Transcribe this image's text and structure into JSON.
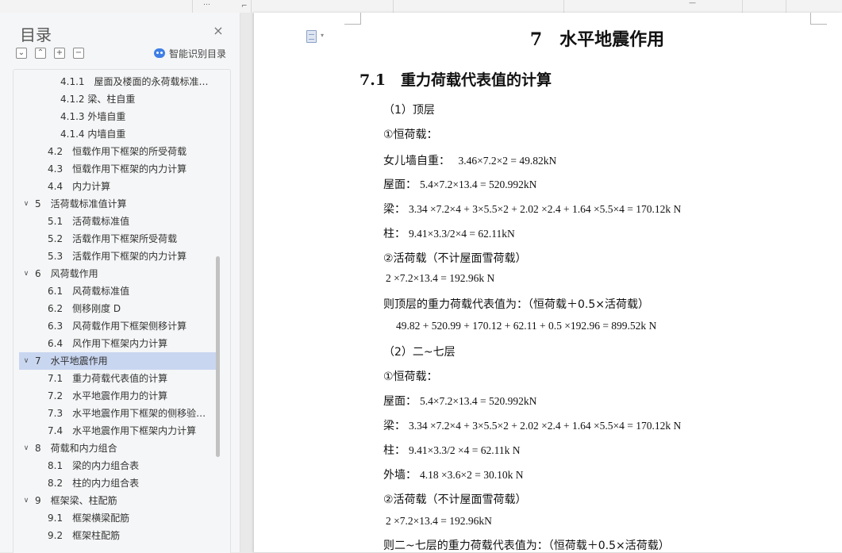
{
  "topbar": {
    "marks": [
      "…",
      "⌐",
      "—"
    ]
  },
  "nav": {
    "title": "目录",
    "close_glyph": "×",
    "tools": [
      "⌄",
      "⌃",
      "+",
      "−"
    ],
    "smart_toc_label": "智能识别目录",
    "items": [
      {
        "level": 3,
        "label": "4.1.1　屋面及楼面的永荷载标准…",
        "expand": ""
      },
      {
        "level": 3,
        "label": "4.1.2 梁、柱自重",
        "expand": ""
      },
      {
        "level": 3,
        "label": "4.1.3 外墙自重",
        "expand": ""
      },
      {
        "level": 3,
        "label": "4.1.4 内墙自重",
        "expand": ""
      },
      {
        "level": 2,
        "label": "4.2　恒载作用下框架的所受荷载",
        "expand": ""
      },
      {
        "level": 2,
        "label": "4.3　恒载作用下框架的内力计算",
        "expand": ""
      },
      {
        "level": 2,
        "label": "4.4　内力计算",
        "expand": ""
      },
      {
        "level": 1,
        "label": "5　活荷载标准值计算",
        "expand": "∨"
      },
      {
        "level": 2,
        "label": "5.1　活荷载标准值",
        "expand": ""
      },
      {
        "level": 2,
        "label": "5.2　活载作用下框架所受荷载",
        "expand": ""
      },
      {
        "level": 2,
        "label": "5.3　活载作用下框架的内力计算",
        "expand": ""
      },
      {
        "level": 1,
        "label": "6　风荷载作用",
        "expand": "∨"
      },
      {
        "level": 2,
        "label": "6.1　风荷载标准值",
        "expand": ""
      },
      {
        "level": 2,
        "label": "6.2　侧移刚度 D",
        "expand": ""
      },
      {
        "level": 2,
        "label": "6.3　风荷载作用下框架侧移计算",
        "expand": ""
      },
      {
        "level": 2,
        "label": "6.4　风作用下框架内力计算",
        "expand": ""
      },
      {
        "level": 1,
        "label": "7　水平地震作用",
        "expand": "∨",
        "active": true
      },
      {
        "level": 2,
        "label": "7.1　重力荷载代表值的计算",
        "expand": ""
      },
      {
        "level": 2,
        "label": "7.2　水平地震作用力的计算",
        "expand": ""
      },
      {
        "level": 2,
        "label": "7.3　水平地震作用下框架的侧移验…",
        "expand": ""
      },
      {
        "level": 2,
        "label": "7.4　水平地震作用下框架内力计算",
        "expand": ""
      },
      {
        "level": 1,
        "label": "8　荷载和内力组合",
        "expand": "∨"
      },
      {
        "level": 2,
        "label": "8.1　梁的内力组合表",
        "expand": ""
      },
      {
        "level": 2,
        "label": "8.2　柱的内力组合表",
        "expand": ""
      },
      {
        "level": 1,
        "label": "9　框架梁、柱配筋",
        "expand": "∨"
      },
      {
        "level": 2,
        "label": "9.1　框架横梁配筋",
        "expand": ""
      },
      {
        "level": 2,
        "label": "9.2　框架柱配筋",
        "expand": ""
      }
    ]
  },
  "document": {
    "chapter": "7　水平地震作用",
    "section": "7.1　重力荷载代表值的计算",
    "lines": [
      {
        "label": "（1）顶层",
        "eq": ""
      },
      {
        "label": "①恒荷载：",
        "eq": ""
      },
      {
        "label": "女儿墙自重：",
        "eq": "　3.46×7.2×2 = 49.82kN"
      },
      {
        "label": "屋面：",
        "eq": "5.4×7.2×13.4 = 520.992kN"
      },
      {
        "label": "梁：",
        "eq": "3.34 ×7.2×4 + 3×5.5×2 + 2.02 ×2.4 + 1.64 ×5.5×4 = 170.12k N"
      },
      {
        "label": "柱：",
        "eq": "9.41×3.3/2×4 = 62.11kN"
      },
      {
        "label": "②活荷载（不计屋面雪荷载）",
        "eq": ""
      },
      {
        "label": "",
        "eq": "2 ×7.2×13.4 = 192.96k N"
      },
      {
        "label": "则顶层的重力荷载代表值为：（恒荷载＋0.5×活荷载）",
        "eq": ""
      },
      {
        "label": "",
        "eq": "49.82 + 520.99 + 170.12 + 62.11 + 0.5 ×192.96 = 899.52k N"
      },
      {
        "label": "（2）二~七层",
        "eq": ""
      },
      {
        "label": "①恒荷载：",
        "eq": ""
      },
      {
        "label": "屋面：",
        "eq": "5.4×7.2×13.4 = 520.992kN"
      },
      {
        "label": "梁：",
        "eq": "3.34 ×7.2×4 + 3×5.5×2 + 2.02 ×2.4 + 1.64 ×5.5×4 = 170.12k N"
      },
      {
        "label": "柱：",
        "eq": "9.41×3.3/2 ×4 = 62.11k N"
      },
      {
        "label": "外墙：",
        "eq": "4.18 ×3.6×2 = 30.10k N"
      },
      {
        "label": "②活荷载（不计屋面雪荷载）",
        "eq": ""
      },
      {
        "label": "",
        "eq": "2 ×7.2×13.4 = 192.96kN"
      },
      {
        "label": "则二~七层的重力荷载代表值为：（恒荷载＋0.5×活荷载）",
        "eq": ""
      }
    ]
  }
}
